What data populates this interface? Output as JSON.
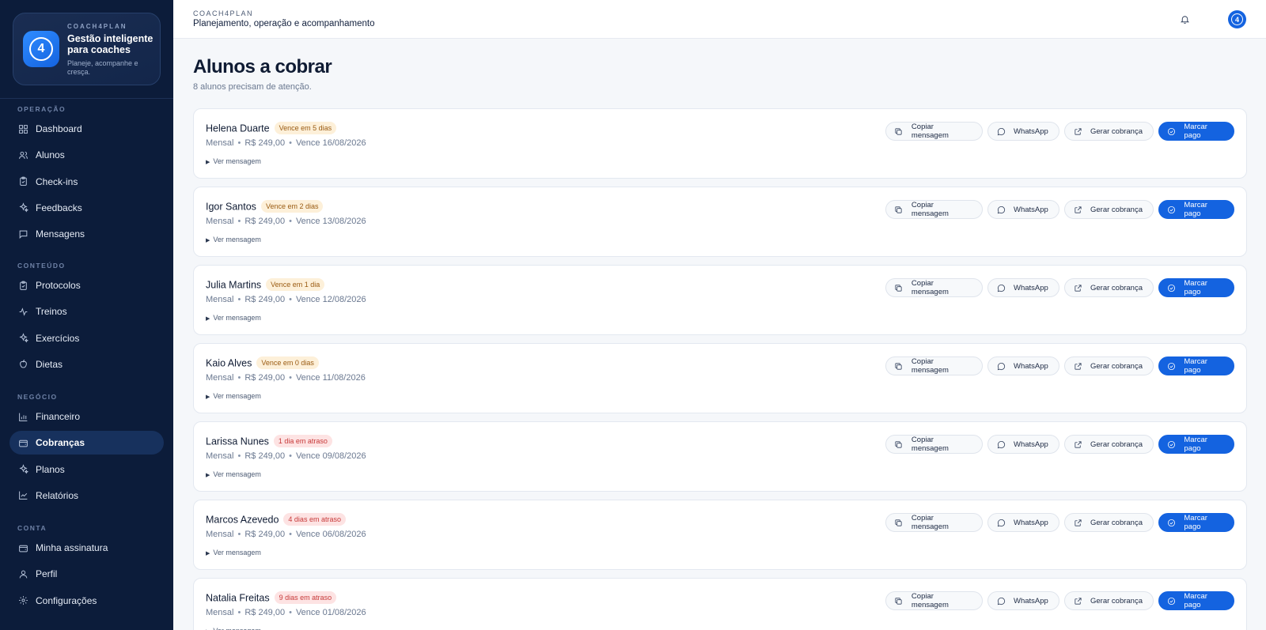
{
  "brand": {
    "overline": "COACH4PLAN",
    "title": "Gestão inteligente para coaches",
    "subtitle": "Planeje, acompanhe e cresça.",
    "logo_text": "4"
  },
  "sidebar": {
    "sections": [
      {
        "label": "OPERAÇÃO",
        "items": [
          {
            "label": "Dashboard",
            "icon": "grid-icon"
          },
          {
            "label": "Alunos",
            "icon": "users-icon"
          },
          {
            "label": "Check-ins",
            "icon": "clipboard-icon"
          },
          {
            "label": "Feedbacks",
            "icon": "sparkle-icon"
          },
          {
            "label": "Mensagens",
            "icon": "message-icon"
          }
        ]
      },
      {
        "label": "CONTEÚDO",
        "items": [
          {
            "label": "Protocolos",
            "icon": "clipboard-icon"
          },
          {
            "label": "Treinos",
            "icon": "activity-icon"
          },
          {
            "label": "Exercícios",
            "icon": "sparkle-icon"
          },
          {
            "label": "Dietas",
            "icon": "apple-icon"
          }
        ]
      },
      {
        "label": "NEGÓCIO",
        "items": [
          {
            "label": "Financeiro",
            "icon": "bar-chart-icon"
          },
          {
            "label": "Cobranças",
            "icon": "wallet-icon",
            "active": true
          },
          {
            "label": "Planos",
            "icon": "sparkle-icon"
          },
          {
            "label": "Relatórios",
            "icon": "line-chart-icon"
          }
        ]
      },
      {
        "label": "CONTA",
        "items": [
          {
            "label": "Minha assinatura",
            "icon": "wallet-icon"
          },
          {
            "label": "Perfil",
            "icon": "user-icon"
          },
          {
            "label": "Configurações",
            "icon": "gear-icon"
          }
        ]
      }
    ]
  },
  "topbar": {
    "overline": "COACH4PLAN",
    "title": "Planejamento, operação e acompanhamento",
    "avatar_text": "4"
  },
  "page": {
    "title": "Alunos a cobrar",
    "subtitle": "8 alunos precisam de atenção."
  },
  "actions": {
    "copy": "Copiar mensagem",
    "whatsapp": "WhatsApp",
    "generate": "Gerar cobrança",
    "mark_paid": "Marcar pago",
    "toggle": "Ver mensagem"
  },
  "students": [
    {
      "name": "Helena Duarte",
      "badge": "Vence em 5 dias",
      "status": "due",
      "plan": "Mensal",
      "amount": "R$ 249,00",
      "due": "Vence 16/08/2026"
    },
    {
      "name": "Igor Santos",
      "badge": "Vence em 2 dias",
      "status": "due",
      "plan": "Mensal",
      "amount": "R$ 249,00",
      "due": "Vence 13/08/2026"
    },
    {
      "name": "Julia Martins",
      "badge": "Vence em 1 dia",
      "status": "due",
      "plan": "Mensal",
      "amount": "R$ 249,00",
      "due": "Vence 12/08/2026"
    },
    {
      "name": "Kaio Alves",
      "badge": "Vence em 0 dias",
      "status": "due",
      "plan": "Mensal",
      "amount": "R$ 249,00",
      "due": "Vence 11/08/2026"
    },
    {
      "name": "Larissa Nunes",
      "badge": "1 dia em atraso",
      "status": "late",
      "plan": "Mensal",
      "amount": "R$ 249,00",
      "due": "Vence 09/08/2026"
    },
    {
      "name": "Marcos Azevedo",
      "badge": "4 dias em atraso",
      "status": "late",
      "plan": "Mensal",
      "amount": "R$ 249,00",
      "due": "Vence 06/08/2026"
    },
    {
      "name": "Natalia Freitas",
      "badge": "9 dias em atraso",
      "status": "late",
      "plan": "Mensal",
      "amount": "R$ 249,00",
      "due": "Vence 01/08/2026"
    }
  ],
  "colors": {
    "sidebar_bg": "#0c1c3a",
    "accent": "#1463e0",
    "due_badge": "#fdf0d9",
    "late_badge": "#fde3e3"
  }
}
